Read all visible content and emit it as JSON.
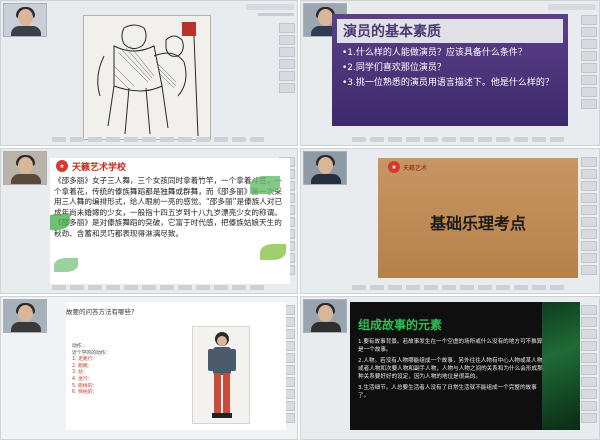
{
  "panel2": {
    "title": "演员的基本素质",
    "items": [
      "•1.什么样的人能做演员？应该具备什么条件？",
      "•2.同学们喜欢那位演员？",
      "•3.挑一位熟悉的演员用语言描述下。他是什么样的？"
    ]
  },
  "panel3": {
    "brand": "天籁艺术学校",
    "body": "《邵多丽》女子三人舞，三个女孩同时拿着竹竿，一个拿着斗笠，一个拿着花，传统的傣族舞蹈都是独舞或群舞，而《邵多丽》第一次采用三人舞的编排形式，给人眼前一亮的感觉。“邵多丽”是傣族人对已成年尚未婚嫁的少女，一般指十四五岁到十八九岁漂亮少女的称谓。《邵多丽》是对傣族舞蹈的突破，它富于时代感，把傣族姑娘天生的秋劲、含蓄和灵巧都表现得淋漓尽致。"
  },
  "panel4": {
    "logo_text": "天籁艺术",
    "title": "基础乐理考点"
  },
  "panel5": {
    "question": "故要的问答方法有哪些？",
    "list": [
      "动作 :",
      "近个学的的动作：",
      "1. 走路行：",
      "2. 跑跳：",
      "3. 站：",
      "4. 坐行：",
      "5. 刚样的：",
      "6. 侧拍的："
    ]
  },
  "panel6": {
    "title": "组成故事的元素",
    "items": [
      "1.要有故事背景。若故事发生在一个空虚的场所或什么没有的地方可不推算是一个故事。",
      "2.人物。若没有人物哪能组成一个故事，另外往往人物有中心人物或某人物或者人物和次要人物和副手人物，人物与人物之间的关系和为什么会形成那种关系要好好的设定，因为人物的地位是很高的。",
      "3.生活细节。人总要生活者人没有了日常生活就不能组成一个完整的故事了。"
    ]
  },
  "colors": {
    "panel_bg": "#e9ecef",
    "purple_slide": "#4a3278",
    "green_accent": "#2fbf55",
    "brand_red": "#c72b22",
    "brown_slide": "#c08c58"
  }
}
